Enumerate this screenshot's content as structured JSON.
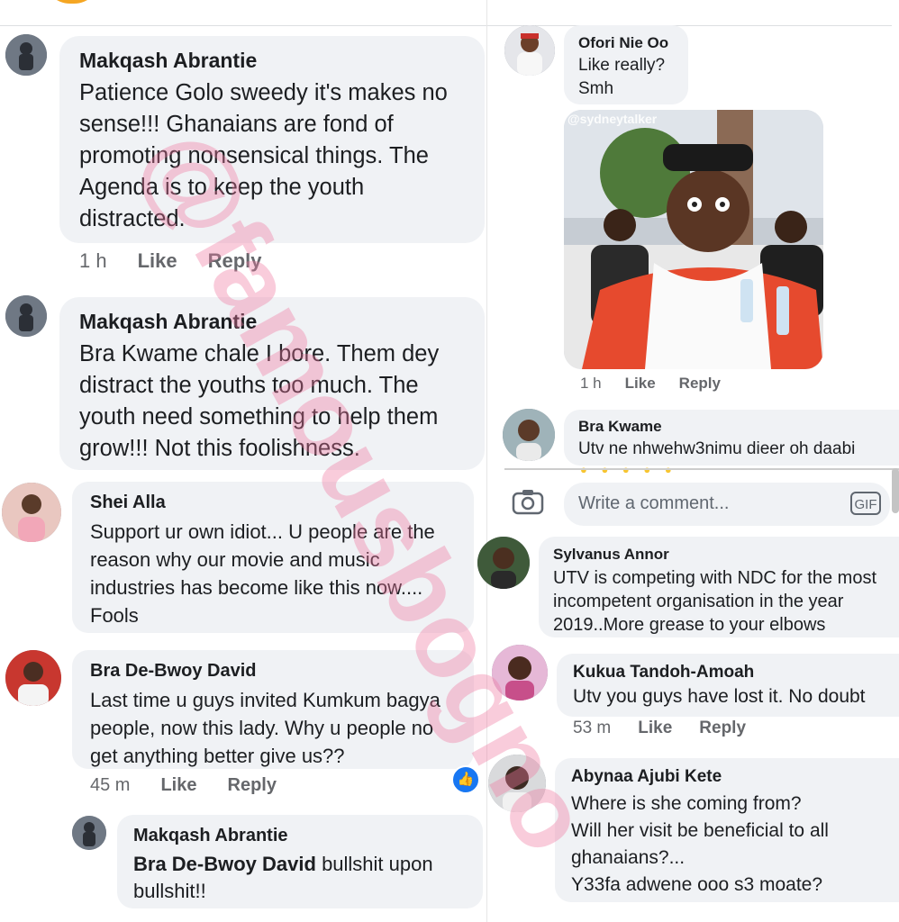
{
  "watermark": "@famousbogno",
  "left": {
    "c1": {
      "name": "Makqash Abrantie",
      "text": "Patience Golo sweedy it's makes no\nsense!!! Ghanaians are fond of\npromoting nonsensical things. The\nAgenda is to keep the youth\ndistracted.",
      "time": "1 h",
      "like": "Like",
      "reply": "Reply"
    },
    "c2": {
      "name": "Makqash Abrantie",
      "text": "Bra Kwame chale I bore. Them dey\ndistract the youths too much. The\nyouth need something to help them\ngrow!!! Not this foolishness."
    },
    "c3": {
      "name": "Shei Alla",
      "text": "Support ur own idiot... U people are the\nreason why our movie and music\nindustries has become like this now....\nFools"
    },
    "c4": {
      "name": "Bra De-Bwoy David",
      "text": "Last time u guys invited Kumkum bagya\npeople, now this lady. Why u people no\nget anything better give us??",
      "time": "45 m",
      "like": "Like",
      "reply": "Reply"
    },
    "c5": {
      "name": "Makqash Abrantie",
      "mention": "Bra De-Bwoy David",
      "text": " bullshit upon\nbullshit!!"
    }
  },
  "right": {
    "r1": {
      "name": "Ofori Nie Oo",
      "text": "Like really?\nSmh",
      "photo_tag": "@sydneytalker",
      "time": "1 h",
      "like": "Like",
      "reply": "Reply"
    },
    "r2": {
      "name": "Bra Kwame",
      "text": "Utv ne nhwehw3nimu dieer oh daabi"
    },
    "input": {
      "placeholder": "Write a comment...",
      "gif": "GIF"
    },
    "r3": {
      "name": "Sylvanus Annor",
      "text": "UTV is competing with NDC for the most\nincompetent organisation in the year\n2019..More grease to your elbows"
    },
    "r4": {
      "name": "Kukua Tandoh-Amoah",
      "text": "Utv you guys have lost it. No doubt",
      "time": "53 m",
      "like": "Like",
      "reply": "Reply"
    },
    "r5": {
      "name": "Abynaa Ajubi Kete",
      "text": "Where is she coming from?\nWill her visit be beneficial to all\nghanaians?...\nY33fa adwene ooo s3 moate?"
    }
  },
  "colors": {
    "bubble": "#f0f2f5",
    "meta": "#65676b",
    "watermark": "#f078a0",
    "like_badge": "#1877f2"
  }
}
